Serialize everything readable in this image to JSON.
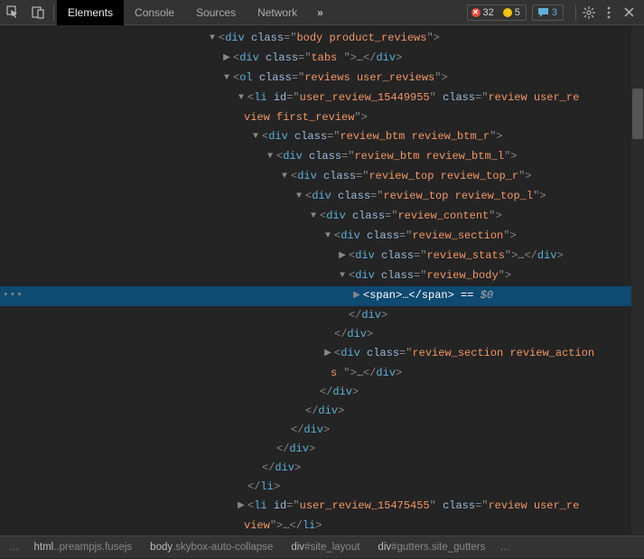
{
  "toolbar": {
    "tabs": [
      "Elements",
      "Console",
      "Sources",
      "Network"
    ],
    "active_tab": 0,
    "errors": "32",
    "warnings": "5",
    "messages": "3"
  },
  "dom_lines": [
    {
      "indent": 230,
      "arrow": "open",
      "kind": "open",
      "tag": "div",
      "attrs": [
        [
          "class",
          "body product_reviews"
        ]
      ]
    },
    {
      "indent": 246,
      "arrow": "closed",
      "kind": "collapsed",
      "tag": "div",
      "attrs": [
        [
          "class",
          "tabs "
        ]
      ]
    },
    {
      "indent": 246,
      "arrow": "open",
      "kind": "open",
      "tag": "ol",
      "attrs": [
        [
          "class",
          "reviews user_reviews"
        ]
      ]
    },
    {
      "indent": 262,
      "arrow": "open",
      "kind": "open-wrap",
      "tag": "li",
      "attrs": [
        [
          "id",
          "user_review_15449955"
        ],
        [
          "class",
          "review user_review first_review"
        ]
      ],
      "wrap_indent": 270
    },
    {
      "indent": 278,
      "arrow": "open",
      "kind": "open",
      "tag": "div",
      "attrs": [
        [
          "class",
          "review_btm review_btm_r"
        ]
      ]
    },
    {
      "indent": 294,
      "arrow": "open",
      "kind": "open",
      "tag": "div",
      "attrs": [
        [
          "class",
          "review_btm review_btm_l"
        ]
      ]
    },
    {
      "indent": 310,
      "arrow": "open",
      "kind": "open",
      "tag": "div",
      "attrs": [
        [
          "class",
          "review_top review_top_r"
        ]
      ]
    },
    {
      "indent": 326,
      "arrow": "open",
      "kind": "open",
      "tag": "div",
      "attrs": [
        [
          "class",
          "review_top review_top_l"
        ]
      ]
    },
    {
      "indent": 342,
      "arrow": "open",
      "kind": "open",
      "tag": "div",
      "attrs": [
        [
          "class",
          "review_content"
        ]
      ]
    },
    {
      "indent": 358,
      "arrow": "open",
      "kind": "open",
      "tag": "div",
      "attrs": [
        [
          "class",
          "review_section"
        ]
      ]
    },
    {
      "indent": 374,
      "arrow": "closed",
      "kind": "collapsed",
      "tag": "div",
      "attrs": [
        [
          "class",
          "review_stats"
        ]
      ]
    },
    {
      "indent": 374,
      "arrow": "open",
      "kind": "open",
      "tag": "div",
      "attrs": [
        [
          "class",
          "review_body"
        ]
      ]
    },
    {
      "indent": 390,
      "arrow": "closed",
      "kind": "span-sel",
      "tag": "span",
      "selected": true
    },
    {
      "indent": 374,
      "arrow": "",
      "kind": "close",
      "tag": "div"
    },
    {
      "indent": 358,
      "arrow": "",
      "kind": "close",
      "tag": "div"
    },
    {
      "indent": 358,
      "arrow": "closed",
      "kind": "collapsed-wrap",
      "tag": "div",
      "attrs": [
        [
          "class",
          "review_section review_actions "
        ]
      ],
      "wrap_indent": 366
    },
    {
      "indent": 342,
      "arrow": "",
      "kind": "close",
      "tag": "div"
    },
    {
      "indent": 326,
      "arrow": "",
      "kind": "close",
      "tag": "div"
    },
    {
      "indent": 310,
      "arrow": "",
      "kind": "close",
      "tag": "div"
    },
    {
      "indent": 294,
      "arrow": "",
      "kind": "close",
      "tag": "div"
    },
    {
      "indent": 278,
      "arrow": "",
      "kind": "close",
      "tag": "div"
    },
    {
      "indent": 262,
      "arrow": "",
      "kind": "close",
      "tag": "li"
    },
    {
      "indent": 262,
      "arrow": "closed",
      "kind": "collapsed-wrap2",
      "tag": "li",
      "attrs": [
        [
          "id",
          "user_review_15475455"
        ],
        [
          "class",
          "review user_review"
        ]
      ],
      "wrap_indent": 270
    }
  ],
  "selected_suffix": "$0",
  "breadcrumbs": [
    {
      "main": "…",
      "suffix": ""
    },
    {
      "main": "html",
      "suffix": "..preampjs.fusejs"
    },
    {
      "main": "body",
      "suffix": ".skybox-auto-collapse"
    },
    {
      "main": "div",
      "suffix": "#site_layout"
    },
    {
      "main": "div",
      "suffix": "#gutters.site_gutters"
    },
    {
      "main": "…",
      "suffix": ""
    }
  ]
}
